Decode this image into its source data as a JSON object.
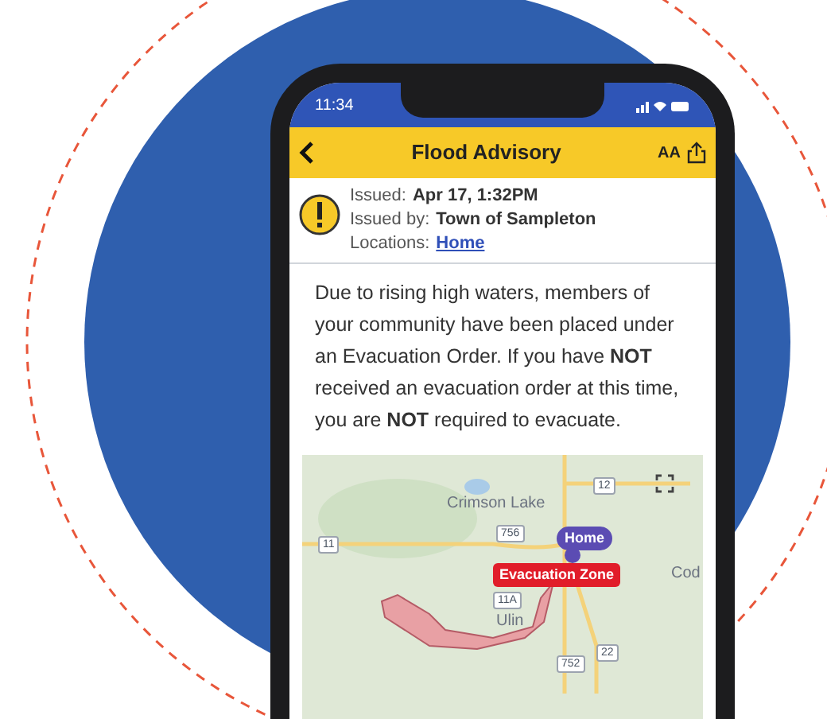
{
  "status_bar": {
    "time": "11:34"
  },
  "header": {
    "title": "Flood Advisory",
    "text_size_label": "AA"
  },
  "advisory": {
    "issued_label": "Issued:",
    "issued_value": "Apr 17, 1:32PM",
    "issued_by_label": "Issued by:",
    "issued_by_value": "Town of Sampleton",
    "locations_label": "Locations:",
    "locations_link": "Home"
  },
  "message": "Due to rising high waters, members of your community have been placed under an Evacuation Order. If you have **NOT** received an evacuation order at this time, you are **NOT** required to evacuate.",
  "map": {
    "labels": [
      {
        "kind": "road",
        "text": "12"
      },
      {
        "kind": "place",
        "text": "Crimson Lake"
      },
      {
        "kind": "road",
        "text": "11"
      },
      {
        "kind": "road",
        "text": "756"
      },
      {
        "kind": "home",
        "text": "Home"
      },
      {
        "kind": "zone",
        "text": "Evacuation Zone"
      },
      {
        "kind": "place",
        "text": "Cod"
      },
      {
        "kind": "road",
        "text": "11A"
      },
      {
        "kind": "place",
        "text": "Ulin"
      },
      {
        "kind": "road",
        "text": "22"
      },
      {
        "kind": "road",
        "text": "752"
      }
    ]
  }
}
